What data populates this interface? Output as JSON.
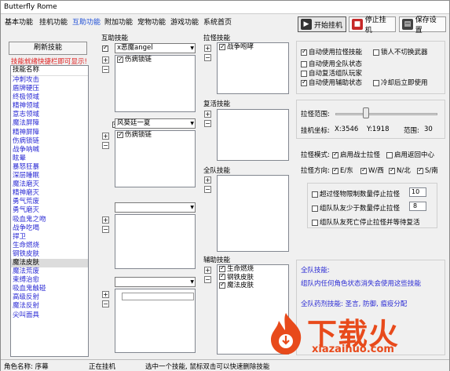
{
  "window": {
    "title": "Butterfly Rome"
  },
  "menu": [
    "基本功能",
    "挂机功能",
    "互助功能",
    "附加功能",
    "宠物功能",
    "游戏功能",
    "系统首页"
  ],
  "toolbar": {
    "start": "开始挂机",
    "stop": "停止挂机",
    "save": "保存设置"
  },
  "left": {
    "refresh": "刷新技能",
    "hint": "技能就绪快捷栏即可显示!",
    "header": "技能名称",
    "skills": [
      "冲刺攻击",
      "盾牌硬压",
      "终极领域",
      "精神领域",
      "意志领域",
      "魔法屏障",
      "精神屏障",
      "伤病锁链",
      "战争呐喊",
      "眩晕",
      "暴怒狂暴",
      "深层睡眠",
      "魔法磨灭",
      "精神磨灭",
      "勇气荒废",
      "勇气磨灭",
      "吸血鬼之吻",
      "战争吃喝",
      "捍卫",
      "生命燃烧",
      "钢铁皮肤",
      "魔法皮肤",
      "魔法荒废",
      "束缚治愈",
      "吸血鬼触碰",
      "高级反射",
      "魔法反射",
      "尖叫面具"
    ],
    "selected": 21
  },
  "mutual": {
    "label": "互助技能",
    "slots": [
      {
        "target": "x恶魔angel",
        "items": [
          "伤病锁链"
        ]
      },
      {
        "target": "风葵廷一夏",
        "items": [
          "伤病锁链"
        ]
      },
      {
        "target": "",
        "items": []
      },
      {
        "target": "",
        "items": []
      }
    ]
  },
  "pull": {
    "label": "拉怪技能",
    "items": [
      "战争咆哮"
    ]
  },
  "revive": {
    "label": "复活技能"
  },
  "party": {
    "label": "全队技能"
  },
  "assist": {
    "label": "辅助技能",
    "items": [
      "生命燃烧",
      "钢铁皮肤",
      "魔法皮肤"
    ]
  },
  "options": {
    "use_pull": "自动使用拉怪技能",
    "lock_weapon": "锁人不切换武器",
    "use_party": "自动使用全队状态",
    "auto_revive": "自动复活组队玩家",
    "use_assist": "自动使用辅助状态",
    "cooldown": "冷却后立即使用"
  },
  "range": {
    "label": "拉怪范围:",
    "value": 0.3,
    "coord_label": "挂机坐标:",
    "x": "X:3546",
    "y": "Y:1918",
    "range_label": "范围:",
    "range_value": "30"
  },
  "mode": {
    "label": "拉怪模式:",
    "warrior": "启用战士拉怪",
    "return": "启用返回中心"
  },
  "dir": {
    "label": "拉怪方向:",
    "e": "E/东",
    "w": "W/西",
    "n": "N/北",
    "s": "S/南"
  },
  "stops": [
    {
      "text": "超过怪物限制数量停止拉怪",
      "value": "10"
    },
    {
      "text": "组队队友少于数量停止拉怪",
      "value": "8"
    },
    {
      "text": "组队队友死亡停止拉怪并等待复活",
      "value": ""
    }
  ],
  "info": {
    "title": "全队技能:",
    "line1": "组队内任何角色状态消失会使用这些技能",
    "title2": "全队药剂技能: 圣言, 防御, 瘟疫分配"
  },
  "status": {
    "name": "角色名称: 序幕",
    "state": "正在挂机",
    "tip": "选中一个技能, 鼠标双击可以快速删除技能"
  },
  "watermark": {
    "text": "下载火",
    "url": "xiazaihuo.com"
  },
  "colors": {
    "accent": "#1f4fd6",
    "skill": "#2a2ad4",
    "hint": "#e02020",
    "wm": "#e84a1b"
  }
}
